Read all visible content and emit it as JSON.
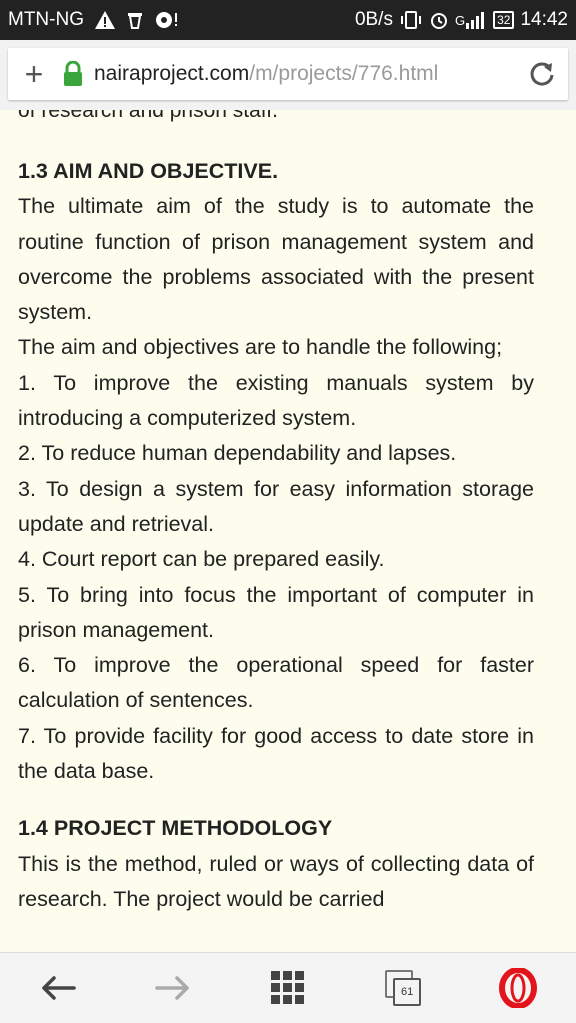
{
  "status_bar": {
    "carrier": "MTN-NG",
    "data_rate": "0B/s",
    "network": "G",
    "battery": "32",
    "time": "14:42"
  },
  "url_bar": {
    "domain": "nairaproject.com",
    "path": "/m/projects/776.html"
  },
  "article": {
    "cut_line": "of research and prison staff.",
    "sections": [
      {
        "heading": "1.3 AIM AND OBJECTIVE.",
        "paragraphs": [
          "The ultimate aim of the study is to automate the routine function of prison management system and overcome the problems associated with the present system.",
          "The aim and objectives are to handle the following;",
          "1. To improve the existing manuals system by introducing a computerized system.",
          "2. To reduce human dependability and lapses.",
          "3. To design a system for easy information storage update and retrieval.",
          "4. Court report can be prepared easily.",
          "5. To bring into focus the important of computer in prison management.",
          "6. To improve the operational speed for faster calculation of sentences.",
          "7. To provide facility for good access to date store in the data base."
        ]
      },
      {
        "heading": "1.4 PROJECT METHODOLOGY",
        "paragraphs": [
          "This is the method, ruled or ways of collecting data of research. The project would be carried"
        ]
      }
    ]
  },
  "bottom_nav": {
    "tab_count": "61",
    "icons": [
      "back-arrow-icon",
      "forward-arrow-icon",
      "speed-dial-grid-icon",
      "tabs-icon",
      "opera-menu-icon"
    ]
  },
  "colors": {
    "page_background": "#fdfdee",
    "status_bar": "#222222",
    "lock_green": "#3aa53a",
    "opera_red": "#e3141c"
  }
}
